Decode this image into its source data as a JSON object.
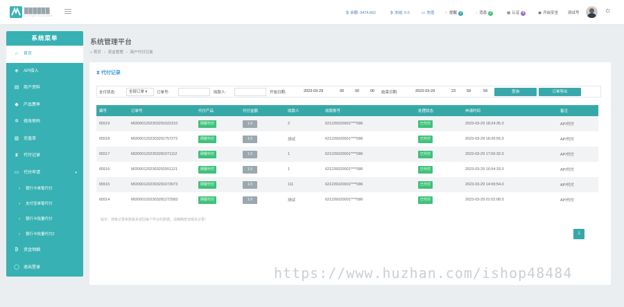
{
  "topbar": {
    "logo_text": "██████",
    "logo_sub": "SYSTEM PLATFORM",
    "balance": "余额: 3474.662",
    "frozen": "冻结: 0.0",
    "recharge": "充值",
    "remind": "提醒",
    "remind_count": "2",
    "message": "消息",
    "message_count": "2",
    "auth": "认证",
    "auth_count": "4",
    "security": "开启安全",
    "username": "测试号",
    "colors": {
      "accent": "#37b1b3",
      "link": "#4a7fc1"
    }
  },
  "sidebar": {
    "title": "系统菜单",
    "items": [
      {
        "icon": "home-icon",
        "label": "首页"
      },
      {
        "icon": "shield-icon",
        "label": "API接入"
      },
      {
        "icon": "id-card-icon",
        "label": "商户资料"
      },
      {
        "icon": "cube-icon",
        "label": "产品费率"
      },
      {
        "icon": "gear-icon",
        "label": "修改密码"
      },
      {
        "icon": "order-icon",
        "label": "充值单"
      },
      {
        "icon": "hourglass-icon",
        "label": "代付记录"
      },
      {
        "icon": "card-icon",
        "label": "代付申请"
      }
    ],
    "sub_items": [
      {
        "label": "银行卡单笔代付"
      },
      {
        "label": "支付宝单笔代付"
      },
      {
        "label": "银行卡批量代付"
      },
      {
        "label": "银行卡批量代付2"
      }
    ],
    "bottom_items": [
      {
        "icon": "bitcoin-icon",
        "label": "资金明细"
      },
      {
        "icon": "power-icon",
        "label": "退出登录"
      }
    ]
  },
  "main": {
    "title": "系统管理平台",
    "breadcrumb": [
      "首页",
      "资金管理",
      "商户代付记录"
    ],
    "panel_title": "代付记录",
    "filter": {
      "status_label": "支付状态:",
      "status_value": "全部订单 ▾",
      "order_label": "订单号:",
      "payee_label": "收款人:",
      "start_label": "开始日期:",
      "start_date": "2023-03-29",
      "start_h": "00",
      "start_m": "00",
      "start_s": "00",
      "end_label": "结束日期:",
      "end_date": "2023-03-29",
      "end_h": "23",
      "end_m": "59",
      "end_s": "59",
      "query_button": "查询",
      "export_button": "订单导出"
    },
    "table": {
      "headers": [
        "编号",
        "订单号",
        "代付产品",
        "代付金额",
        "收款人",
        "收款账号",
        "处理状态",
        "申请时间",
        "备注"
      ],
      "rows": [
        {
          "id": "65519",
          "order": "MI20001202303291022210",
          "product": "网银代付",
          "amount": "1.0",
          "payee": "2",
          "account": "621226020001****086",
          "status": "已代付",
          "time": "2023-03-29 18:24:35.0",
          "remark": "API代付"
        },
        {
          "id": "65518",
          "order": "MI20001202303291757272",
          "product": "网银代付",
          "amount": "1.0",
          "payee": "测试",
          "account": "621226020001****086",
          "status": "已代付",
          "time": "2023-03-29 18:26:55.0",
          "remark": "API代付"
        },
        {
          "id": "65517",
          "order": "MI20001202303281071112",
          "product": "网银代付",
          "amount": "1.0",
          "payee": "1",
          "account": "621226020001****086",
          "status": "已代付",
          "time": "2023-03-29 17:56:32.0",
          "remark": "API代付"
        },
        {
          "id": "65516",
          "order": "MI20001202303291551121",
          "product": "网银代付",
          "amount": "1.0",
          "payee": "1",
          "account": "621226020001****086",
          "status": "已代付",
          "time": "2023-03-29 16:54:33.0",
          "remark": "API代付"
        },
        {
          "id": "65515",
          "order": "MI20001202303291073073",
          "product": "网银代付",
          "amount": "1.0",
          "payee": "111",
          "account": "621226020001****086",
          "status": "已代付",
          "time": "2023-03-29 14:09:54.0",
          "remark": "API代付"
        },
        {
          "id": "65514",
          "order": "MI20001202303281272583",
          "product": "网银代付",
          "amount": "1.0",
          "payee": "测试",
          "account": "621226020001****086",
          "status": "已代付",
          "time": "2023-03-29 01:02:08.0",
          "remark": "API代付"
        }
      ]
    },
    "note": "提示：搜索记录条数最多返回每个符合的数据，请精确查询相关记录！",
    "page": "1"
  },
  "watermark": "https://www.huzhan.com/ishop48484"
}
